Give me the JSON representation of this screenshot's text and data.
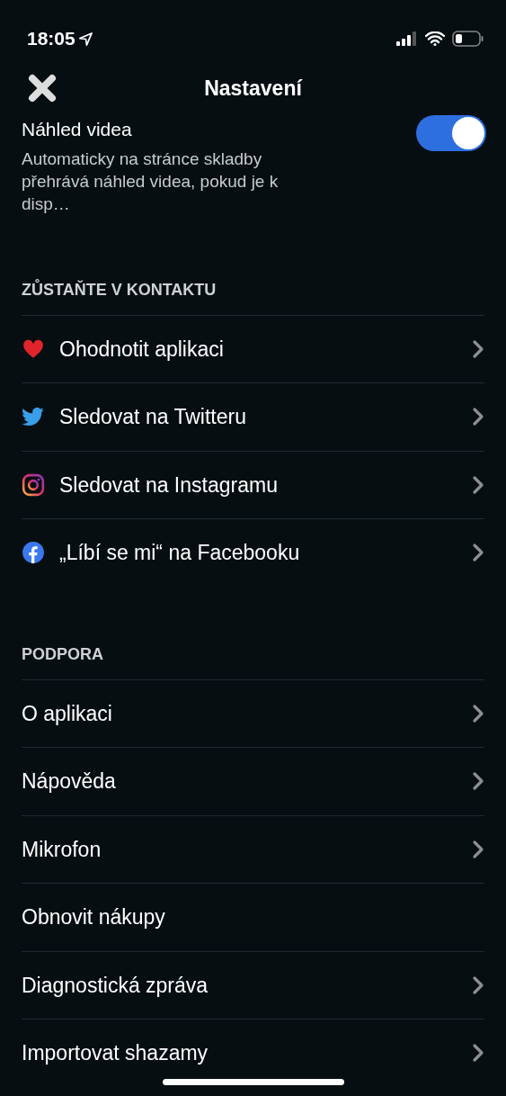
{
  "status_bar": {
    "time": "18:05"
  },
  "header": {
    "title": "Nastavení"
  },
  "video_preview": {
    "title": "Náhled videa",
    "description": "Automaticky na stránce skladby přehrává náhled videa, pokud je k disp…",
    "on": true
  },
  "sections": [
    {
      "title": "ZŮSTAŇTE V KONTAKTU",
      "items": [
        {
          "label": "Ohodnotit aplikaci",
          "kind": "heart",
          "chevron": true
        },
        {
          "label": "Sledovat na Twitteru",
          "kind": "twitter",
          "chevron": true
        },
        {
          "label": "Sledovat na Instagramu",
          "kind": "instagram",
          "chevron": true
        },
        {
          "label": "„Líbí se mi“ na Facebooku",
          "kind": "facebook",
          "chevron": true
        }
      ]
    },
    {
      "title": "PODPORA",
      "items": [
        {
          "label": "O aplikaci",
          "chevron": true
        },
        {
          "label": "Nápověda",
          "chevron": true
        },
        {
          "label": "Mikrofon",
          "chevron": true
        },
        {
          "label": "Obnovit nákupy",
          "chevron": false
        },
        {
          "label": "Diagnostická zpráva",
          "chevron": true
        },
        {
          "label": "Importovat shazamy",
          "chevron": true
        }
      ]
    }
  ]
}
